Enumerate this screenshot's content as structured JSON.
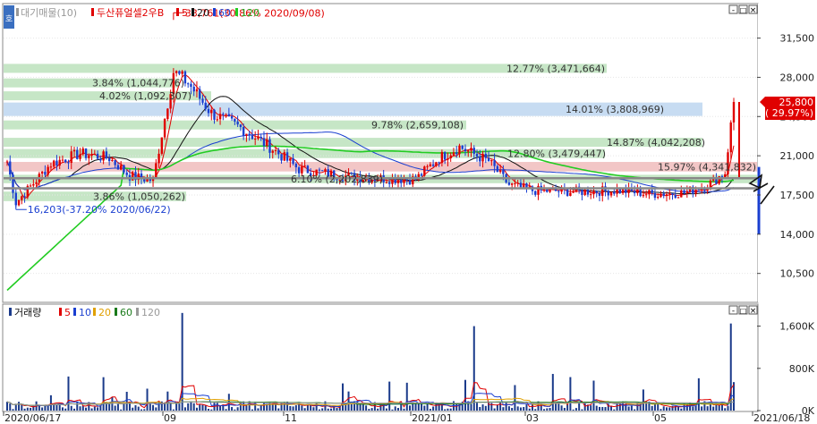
{
  "price_panel": {
    "legend": {
      "indicator": "대기매물(10)",
      "stock": "두산퓨얼셀2우B",
      "ma": [
        "5",
        "20",
        "60",
        "120"
      ],
      "ma_colors": [
        "#e00000",
        "#111111",
        "#1a3fd0",
        "#22cc22"
      ]
    },
    "buttons": [
      "-",
      "□",
      "×"
    ],
    "side_tab": "호",
    "annotations": {
      "high": "33,761(30.86% 2020/09/08)",
      "low": "16,203(-37.20% 2020/06/22)",
      "last": "25,800",
      "last_change": "( 29.97%)"
    }
  },
  "volume_panel": {
    "legend": {
      "title": "거래량",
      "ma": [
        "5",
        "10",
        "20",
        "60",
        "120"
      ],
      "ma_colors": [
        "#e00000",
        "#1a3fd0",
        "#e0a000",
        "#1a7a1a",
        "#999999"
      ]
    },
    "buttons": [
      "-",
      "□",
      "×"
    ]
  },
  "x_axis": {
    "labels": [
      "2020/06/17",
      "09",
      "11",
      "2021/01",
      "03",
      "05",
      "2021/06/18"
    ]
  },
  "chart_data": [
    {
      "type": "candlestick",
      "title": "두산퓨얼셀2우B",
      "y_ticks": [
        "31,500",
        "28,000",
        "24,500",
        "21,000",
        "17,500",
        "14,000",
        "10,500"
      ],
      "ylim": [
        8000,
        34500
      ],
      "last_price": 25800,
      "last_change_pct": 29.97,
      "high": {
        "value": 33761,
        "pct": 30.86,
        "date": "2020/09/08"
      },
      "low": {
        "value": 16203,
        "pct": -37.2,
        "date": "2020/06/22"
      },
      "supply_zones": [
        {
          "label": "12.77% (3,471,664)",
          "price_lo": 28400,
          "price_hi": 29200
        },
        {
          "label": "3.84% (1,044,776)",
          "price_lo": 27100,
          "price_hi": 27900
        },
        {
          "label": "4.02% (1,092,307)",
          "price_lo": 25950,
          "price_hi": 26750
        },
        {
          "label": "14.01% (3,808,969)",
          "price_lo": 24550,
          "price_hi": 25750
        },
        {
          "label": "9.78% (2,659,108)",
          "price_lo": 23350,
          "price_hi": 24150
        },
        {
          "label": "14.87% (4,042,208)",
          "price_lo": 21800,
          "price_hi": 22600
        },
        {
          "label": "12.80% (3,479,447)",
          "price_lo": 20800,
          "price_hi": 21600
        },
        {
          "label": "15.97% (4,341,832)",
          "price_lo": 19600,
          "price_hi": 20450
        },
        {
          "label": "6.10% (2,202,839)",
          "price_lo": 18550,
          "price_hi": 19300
        },
        {
          "label": "3.86% (1,050,262)",
          "price_lo": 16950,
          "price_hi": 17800
        }
      ],
      "x_labels": [
        "2020/06/17",
        "09",
        "11",
        "2021/01",
        "03",
        "05",
        "2021/06/18"
      ]
    },
    {
      "type": "bar",
      "title": "거래량",
      "y_ticks": [
        "1,600K",
        "800K",
        "0K"
      ],
      "ylim": [
        0,
        2000000
      ],
      "peaks": [
        {
          "date": "2020/09",
          "value": 1850000
        },
        {
          "date": "2021/01",
          "value": 1600000
        },
        {
          "date": "2021/06/18",
          "value": 1650000
        }
      ]
    }
  ]
}
